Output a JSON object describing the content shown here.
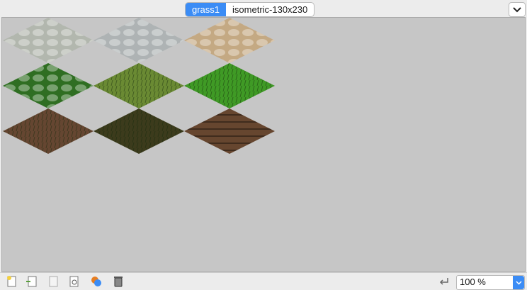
{
  "tabs": [
    {
      "label": "grass1",
      "active": true
    },
    {
      "label": "isometric-130x230",
      "active": false
    }
  ],
  "zoom": {
    "value": "100 %"
  },
  "tiles": [
    {
      "name": "cobblestone-mossy",
      "c1": "#b8bcb4",
      "c2": "#5e7a4e"
    },
    {
      "name": "cobblestone-grey",
      "c1": "#c0c3c4",
      "c2": "#4c5556"
    },
    {
      "name": "pebbles-sand",
      "c1": "#c9b08e",
      "c2": "#6e5a44"
    },
    {
      "name": "stepping-stones-grass",
      "c1": "#2f6e22",
      "c2": "#b5b8b3"
    },
    {
      "name": "tall-grass",
      "c1": "#6e8f35",
      "c2": "#3f5c1d"
    },
    {
      "name": "green-grass",
      "c1": "#3e9a24",
      "c2": "#2a6e18"
    },
    {
      "name": "dirt-weeds",
      "c1": "#6b4b34",
      "c2": "#3f6a25"
    },
    {
      "name": "dark-roots",
      "c1": "#3a3a1a",
      "c2": "#5c5e26"
    },
    {
      "name": "wood-planks",
      "c1": "#6a4a33",
      "c2": "#3b271b"
    }
  ]
}
